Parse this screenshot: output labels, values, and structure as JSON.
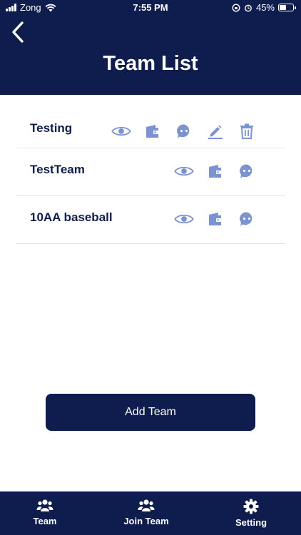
{
  "status_bar": {
    "carrier": "Zong",
    "time": "7:55 PM",
    "battery": "45%"
  },
  "header": {
    "title": "Team List",
    "back_icon": "chevron-left-icon"
  },
  "teams": [
    {
      "name": "Testing",
      "actions": [
        "view",
        "wallet",
        "chat",
        "edit",
        "delete"
      ]
    },
    {
      "name": "TestTeam",
      "actions": [
        "view",
        "wallet",
        "chat"
      ]
    },
    {
      "name": "10AA baseball",
      "actions": [
        "view",
        "wallet",
        "chat"
      ]
    }
  ],
  "add_team": {
    "label": "Add Team"
  },
  "tab_bar": {
    "tabs": [
      {
        "label": "Team",
        "icon": "users-icon"
      },
      {
        "label": "Join Team",
        "icon": "users-icon"
      },
      {
        "label": "Setting",
        "icon": "gear-icon"
      }
    ]
  },
  "colors": {
    "primary": "#0e1d4d",
    "icon_accent": "#7b93d1",
    "divider": "#e3e5ea"
  }
}
